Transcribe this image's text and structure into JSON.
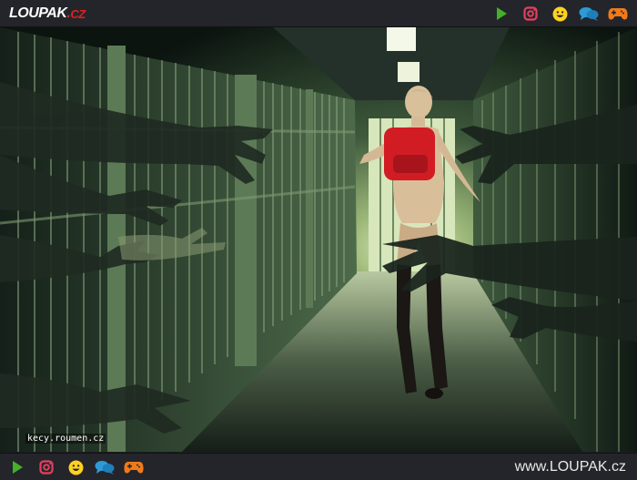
{
  "header": {
    "logo_main": "LOUPAK",
    "logo_dot": ".",
    "logo_tld": "CZ",
    "icons": [
      "play-icon",
      "instagram-icon",
      "smiley-icon",
      "chat-icon",
      "gamepad-icon"
    ]
  },
  "image": {
    "watermark": "kecy.roumen.cz"
  },
  "footer": {
    "icons": [
      "play-icon",
      "instagram-icon",
      "smiley-icon",
      "chat-icon",
      "gamepad-icon"
    ],
    "site_url": "www.LOUPAK.cz"
  },
  "colors": {
    "bar_bg": "#23252a",
    "play": "#43b02a",
    "instagram": "#e4405f",
    "smiley": "#ffd21f",
    "chat": "#2e9bd6",
    "gamepad": "#f07a1a"
  }
}
